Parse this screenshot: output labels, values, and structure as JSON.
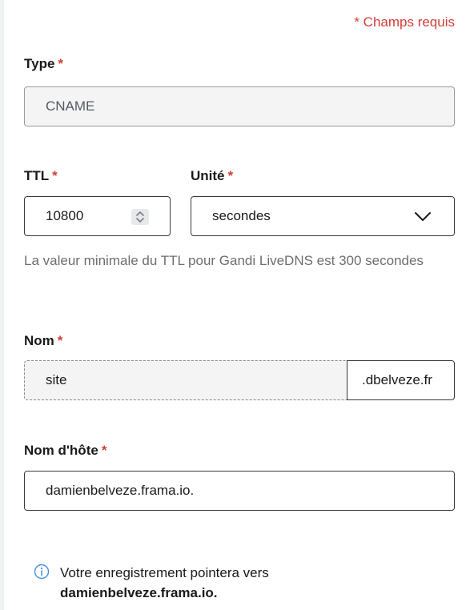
{
  "required_note": "* Champs requis",
  "type": {
    "label": "Type",
    "star": "*",
    "value": "CNAME"
  },
  "ttl": {
    "label": "TTL",
    "star": "*",
    "value": "10800",
    "spinner_icon": "up-down-chevron-icon"
  },
  "unit": {
    "label": "Unité",
    "star": "*",
    "value": "secondes",
    "icon": "chevron-down-icon"
  },
  "ttl_help": "La valeur minimale du TTL pour Gandi LiveDNS est 300 secondes",
  "name": {
    "label": "Nom",
    "star": "*",
    "value": "site",
    "suffix": ".dbelveze.fr"
  },
  "hostname": {
    "label": "Nom d'hôte",
    "star": "*",
    "value": "damienbelveze.frama.io."
  },
  "info": {
    "icon": "info-icon",
    "text": "Votre enregistrement pointera vers",
    "target": "damienbelveze.frama.io."
  },
  "colors": {
    "required": "#d23f3a",
    "help_text": "#6e6e6e",
    "info_icon": "#4a90d9"
  }
}
